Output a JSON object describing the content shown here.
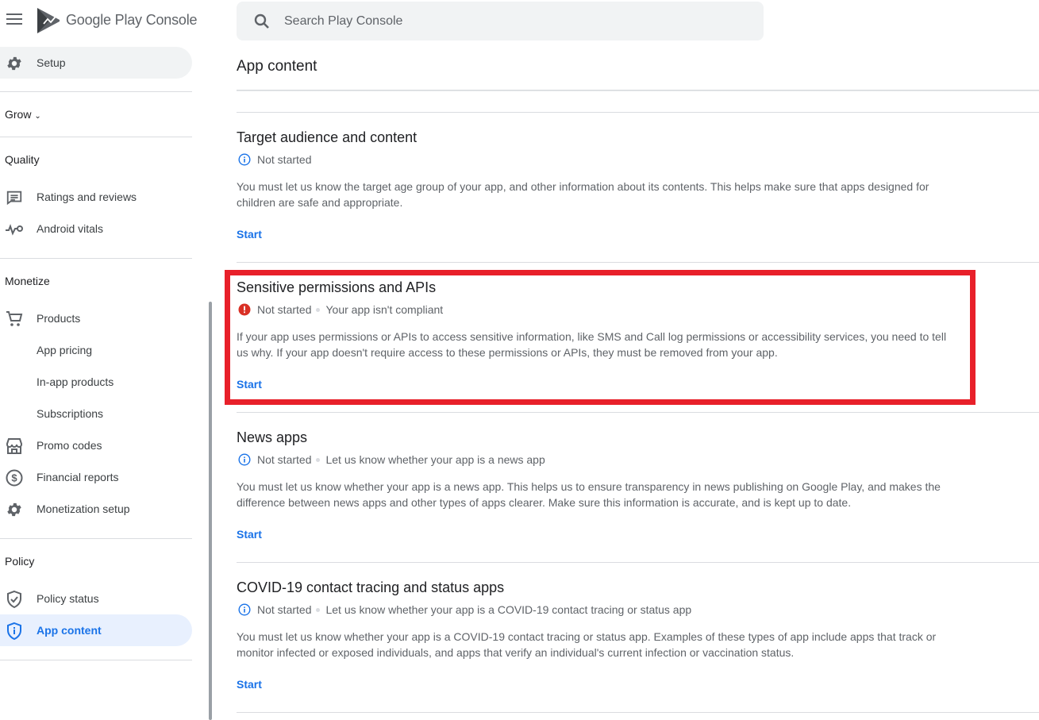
{
  "app": {
    "logo_google": "Google Play",
    "logo_console": "Console"
  },
  "search": {
    "placeholder": "Search Play Console"
  },
  "nav": {
    "setup": "Setup",
    "grow": "Grow",
    "quality": "Quality",
    "ratings": "Ratings and reviews",
    "vitals": "Android vitals",
    "monetize": "Monetize",
    "products": "Products",
    "app_pricing": "App pricing",
    "in_app_products": "In-app products",
    "subscriptions": "Subscriptions",
    "promo_codes": "Promo codes",
    "financial_reports": "Financial reports",
    "monetization_setup": "Monetization setup",
    "policy": "Policy",
    "policy_status": "Policy status",
    "app_content": "App content"
  },
  "page": {
    "title": "App content"
  },
  "sections": [
    {
      "title": "Target audience and content",
      "status": "Not started",
      "status_icon": "info-icon",
      "detail": "",
      "description": "You must let us know the target age group of your app, and other information about its contents. This helps make sure that apps designed for children are safe and appropriate.",
      "action": "Start"
    },
    {
      "title": "Sensitive permissions and APIs",
      "status": "Not started",
      "status_icon": "error-icon",
      "detail": "Your app isn't compliant",
      "description": "If your app uses permissions or APIs to access sensitive information, like SMS and Call log permissions or accessibility services, you need to tell us why. If your app doesn't require access to these permissions or APIs, they must be removed from your app.",
      "action": "Start"
    },
    {
      "title": "News apps",
      "status": "Not started",
      "status_icon": "info-icon",
      "detail": "Let us know whether your app is a news app",
      "description": "You must let us know whether your app is a news app. This helps us to ensure transparency in news publishing on Google Play, and makes the difference between news apps and other types of apps clearer. Make sure this information is accurate, and is kept up to date.",
      "action": "Start"
    },
    {
      "title": "COVID-19 contact tracing and status apps",
      "status": "Not started",
      "status_icon": "info-icon",
      "detail": "Let us know whether your app is a COVID-19 contact tracing or status app",
      "description": "You must let us know whether your app is a COVID-19 contact tracing or status app. Examples of these types of app include apps that track or monitor infected or exposed individuals, and apps that verify an individual's current infection or vaccination status.",
      "action": "Start"
    }
  ],
  "colors": {
    "accent": "#1a73e8",
    "highlight": "#e8202a",
    "error": "#d93025"
  }
}
